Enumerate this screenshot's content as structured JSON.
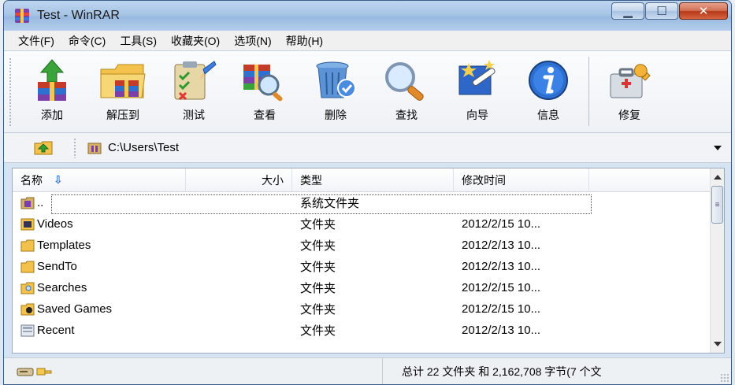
{
  "window": {
    "title": "Test - WinRAR"
  },
  "menu": {
    "items": [
      "文件(F)",
      "命令(C)",
      "工具(S)",
      "收藏夹(O)",
      "选项(N)",
      "帮助(H)"
    ]
  },
  "toolbar": {
    "buttons": [
      {
        "label": "添加",
        "icon": "add-archive-icon"
      },
      {
        "label": "解压到",
        "icon": "extract-to-icon"
      },
      {
        "label": "测试",
        "icon": "test-icon"
      },
      {
        "label": "查看",
        "icon": "view-icon"
      },
      {
        "label": "删除",
        "icon": "delete-icon"
      },
      {
        "label": "查找",
        "icon": "find-icon"
      },
      {
        "label": "向导",
        "icon": "wizard-icon"
      },
      {
        "label": "信息",
        "icon": "info-icon"
      },
      {
        "label": "修复",
        "icon": "repair-icon"
      }
    ]
  },
  "address": {
    "path": "C:\\Users\\Test"
  },
  "list": {
    "columns": {
      "name": "名称",
      "size": "大小",
      "type": "类型",
      "modified": "修改时间"
    },
    "rows": [
      {
        "name": "..",
        "size": "",
        "type": "系统文件夹",
        "modified": ""
      },
      {
        "name": "Videos",
        "size": "",
        "type": "文件夹",
        "modified": "2012/2/15 10..."
      },
      {
        "name": "Templates",
        "size": "",
        "type": "文件夹",
        "modified": "2012/2/13 10..."
      },
      {
        "name": "SendTo",
        "size": "",
        "type": "文件夹",
        "modified": "2012/2/13 10..."
      },
      {
        "name": "Searches",
        "size": "",
        "type": "文件夹",
        "modified": "2012/2/15 10..."
      },
      {
        "name": "Saved Games",
        "size": "",
        "type": "文件夹",
        "modified": "2012/2/15 10..."
      },
      {
        "name": "Recent",
        "size": "",
        "type": "文件夹",
        "modified": "2012/2/13 10..."
      }
    ]
  },
  "status": {
    "text": "总计 22 文件夹 和 2,162,708 字节(7 个文"
  }
}
